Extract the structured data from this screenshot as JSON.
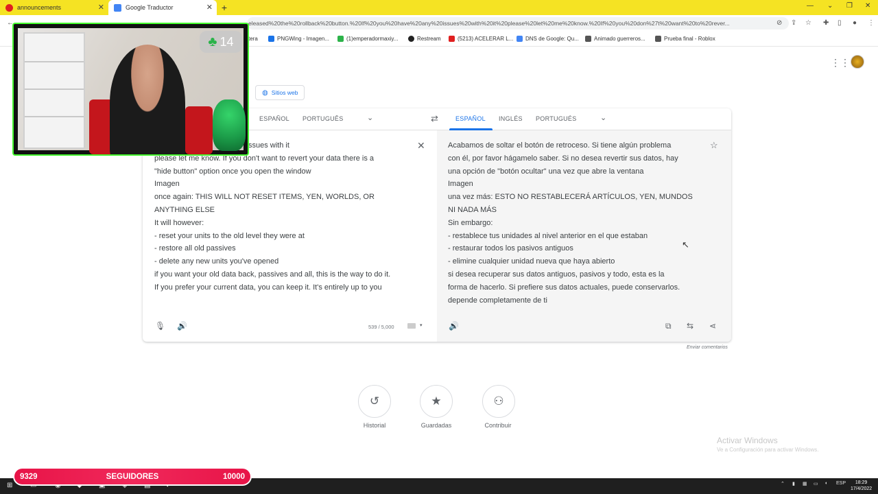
{
  "browser": {
    "tabs": [
      {
        "title": "announcements",
        "favicon_color": "#e02020",
        "active": false
      },
      {
        "title": "Google Traductor",
        "favicon_color": "#4285f4",
        "active": true
      }
    ],
    "new_tab": "+",
    "close": "✕",
    "url": "eleased%20the%20rollback%20button.%20If%20you%20have%20any%20issues%20with%20it%20please%20let%20me%20know.%20If%20you%20don%27t%20want%20to%20rever...",
    "bookmarks": [
      {
        "label": "tera",
        "color": "#ff9800"
      },
      {
        "label": "PNGWing - Imagen...",
        "color": "#1a73e8"
      },
      {
        "label": "(1)emperadormaxiy...",
        "color": "#2db34a"
      },
      {
        "label": "Restream",
        "color": "#222222"
      },
      {
        "label": "(5213) ACELERAR L...",
        "color": "#e02020"
      },
      {
        "label": "DNS de Google: Qu...",
        "color": "#4285f4"
      },
      {
        "label": "Animado guerreros...",
        "color": "#555555"
      },
      {
        "label": "Prueba final - Roblox",
        "color": "#555555"
      }
    ]
  },
  "stream": {
    "badge_count": "14",
    "followers_current": "9329",
    "followers_label": "SEGUIDORES",
    "followers_goal": "10000"
  },
  "translate": {
    "sites_chip": "Sitios web",
    "source_langs": [
      "ESPAÑOL",
      "PORTUGUÊS"
    ],
    "target_langs": [
      "ESPAÑOL",
      "INGLÉS",
      "PORTUGUÉS"
    ],
    "swap_icon": "⇄",
    "source_text": "ack button. If you have any issues with it\nplease let me know. If you don't want to revert your data there is a\n\"hide button\" option once you open the window\nImagen\nonce again: THIS WILL NOT RESET ITEMS, YEN, WORLDS, OR\nANYTHING ELSE\nIt will however:\n- reset your units to the old level they were at\n- restore all old passives\n- delete any new units you've opened\nif you want your old data back, passives and all, this is the way to do it.\nIf you prefer your current data, you can keep it. It's entirely up to you",
    "target_text": "Acabamos de soltar el botón de retroceso. Si tiene algún problema\ncon él, por favor hágamelo saber. Si no desea revertir sus datos, hay\nuna opción de \"botón ocultar\" una vez que abre la ventana\nImagen\nuna vez más: ESTO NO RESTABLECERÁ ARTÍCULOS, YEN, MUNDOS\nNI NADA MÁS\nSin embargo:\n- restablece tus unidades al nivel anterior en el que estaban\n- restaurar todos los pasivos antiguos\n- elimine cualquier unidad nueva que haya abierto\nsi desea recuperar sus datos antiguos, pasivos y todo, esta es la\nforma de hacerlo. Si prefiere sus datos actuales, puede conservarlos.\ndepende completamente de ti",
    "char_count": "539 / 5,000",
    "feedback": "Enviar comentarios",
    "bottom_buttons": [
      {
        "label": "Historial",
        "icon": "history-icon"
      },
      {
        "label": "Guardadas",
        "icon": "star-icon"
      },
      {
        "label": "Contribuir",
        "icon": "people-icon"
      }
    ]
  },
  "windows": {
    "activate_title": "Activar Windows",
    "activate_sub": "Ve a Configuración para activar Windows.",
    "lang": "ESP",
    "time": "18:29",
    "date": "17/4/2022"
  }
}
